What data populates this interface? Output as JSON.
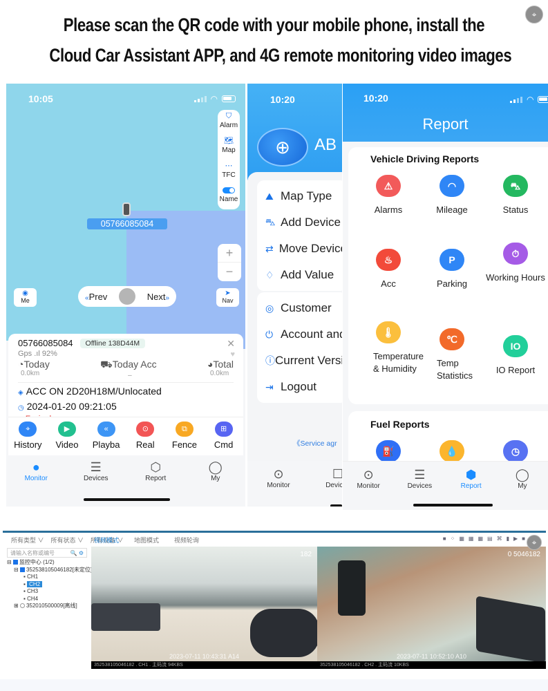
{
  "headline": {
    "line1": "Please scan the QR code with your mobile phone, install the",
    "line2": "Cloud Car Assistant APP, and 4G remote monitoring video images"
  },
  "overlay": {
    "lens_icon": "⌖"
  },
  "phone_monitor": {
    "time": "10:05",
    "side_panel": [
      {
        "icon": "shield-alert-icon",
        "glyph": "⛉",
        "label": "Alarm"
      },
      {
        "icon": "map-icon",
        "glyph": "🗺",
        "label": "Map"
      },
      {
        "icon": "tf-card-icon",
        "glyph": "⋯",
        "label": "TFC"
      },
      {
        "icon": "toggle-icon",
        "glyph": "",
        "label": "Name",
        "toggle_on": true
      }
    ],
    "vehicle_plate": "05766085084",
    "zoom": {
      "plus": "+",
      "minus": "−"
    },
    "me_label": "Me",
    "nav_label": "Nav",
    "prev_label": "Prev",
    "next_label": "Next",
    "card": {
      "device_id": "05766085084",
      "status_badge": "Offline 138D44M",
      "gps": "Gps ⁠.ıl 92%",
      "stats": [
        {
          "icon": "speedometer-icon",
          "glyph": "◔",
          "label": "Today",
          "value": "0.0km"
        },
        {
          "icon": "truck-icon",
          "glyph": "⛟",
          "label": "Today Acc",
          "value": "–"
        },
        {
          "icon": "gauge-icon",
          "glyph": "◕",
          "label": "Total",
          "value": "0.0km"
        }
      ],
      "acc_line": "ACC ON 2D20H18M/Unlocated",
      "datetime": "2024-01-20 09:21:05",
      "expired": "Expired"
    },
    "actions": [
      {
        "label": "History",
        "color": "#2f86f6",
        "glyph": "⌖"
      },
      {
        "label": "Video",
        "color": "#22c08f",
        "glyph": "▶"
      },
      {
        "label": "Playba",
        "color": "#3d95f5",
        "glyph": "«"
      },
      {
        "label": "Real",
        "color": "#f25555",
        "glyph": "⊙"
      },
      {
        "label": "Fence",
        "color": "#f8a823",
        "glyph": "⧉"
      },
      {
        "label": "Cmd",
        "color": "#5865f2",
        "glyph": "⊞"
      }
    ],
    "tabs": [
      {
        "label": "Monitor",
        "glyph": "●",
        "active": true
      },
      {
        "label": "Devices",
        "glyph": "☰",
        "active": false
      },
      {
        "label": "Report",
        "glyph": "⬡",
        "active": false
      },
      {
        "label": "My",
        "glyph": "◯",
        "active": false
      }
    ]
  },
  "phone_my": {
    "time": "10:20",
    "brand": "AB",
    "menu_group1": [
      {
        "label": "Map Type",
        "glyph": "⛰"
      },
      {
        "label": "Add Device",
        "glyph": "⛍"
      },
      {
        "label": "Move Device",
        "glyph": "⇄"
      },
      {
        "label": "Add Value",
        "glyph": "♢"
      }
    ],
    "menu_group2": [
      {
        "label": "Customer",
        "glyph": "◎"
      },
      {
        "label": "Account and",
        "glyph": "⏻"
      },
      {
        "label": "Current Version",
        "glyph": "ⓘ"
      },
      {
        "label": "Logout",
        "glyph": "⇥"
      }
    ],
    "service_link": "《Service agr",
    "tabs": [
      {
        "label": "Monitor",
        "glyph": "⊙"
      },
      {
        "label": "Devices",
        "glyph": "☐"
      }
    ]
  },
  "phone_report": {
    "time": "10:20",
    "title": "Report",
    "vehicle_section": {
      "title": "Vehicle Driving Reports",
      "items": [
        {
          "label": "Alarms",
          "color": "#f25a5a",
          "glyph": "⚠"
        },
        {
          "label": "Mileage",
          "color": "#2f86f6",
          "glyph": "◠"
        },
        {
          "label": "Status",
          "color": "#24b860",
          "glyph": "⛍"
        },
        {
          "label": "Acc",
          "color": "#f24a3a",
          "glyph": "♨"
        },
        {
          "label": "Parking",
          "color": "#2f86f6",
          "glyph": "P"
        },
        {
          "label": "Working Hours",
          "color": "#a55be6",
          "glyph": "⏱"
        },
        {
          "label": "Temperature & Humidity",
          "color": "#fbbf3d",
          "glyph": "🌡"
        },
        {
          "label": "Temp Statistics",
          "color": "#f26a2a",
          "glyph": "℃"
        },
        {
          "label": "IO Report",
          "color": "#22cf9a",
          "glyph": "IO"
        }
      ]
    },
    "fuel_section": {
      "title": "Fuel Reports",
      "items": [
        {
          "color": "#2f6ff6",
          "glyph": "⛽"
        },
        {
          "color": "#fbb52d",
          "glyph": "💧"
        },
        {
          "color": "#5872f2",
          "glyph": "◷"
        }
      ]
    },
    "tabs": [
      {
        "label": "Monitor",
        "glyph": "⊙",
        "active": false
      },
      {
        "label": "Devices",
        "glyph": "☰",
        "active": false
      },
      {
        "label": "Report",
        "glyph": "⬢",
        "active": true
      },
      {
        "label": "My",
        "glyph": "◯",
        "active": false
      }
    ]
  },
  "desktop": {
    "filters": [
      "所有类型 ∨",
      "所有状态 ∨",
      "所有设备 ∨"
    ],
    "view_tabs": [
      {
        "label": "视频模式",
        "active": true
      },
      {
        "label": "地图模式",
        "active": false
      },
      {
        "label": "视频轮询",
        "active": false
      }
    ],
    "toolbar": [
      "■",
      "⁘",
      "▦",
      "▦",
      "▦",
      "▤",
      "⌘",
      "▮",
      "▶",
      "■"
    ],
    "search_placeholder": "请输入名称或编号",
    "tree": [
      {
        "label": "监控中心 (1/2)",
        "level": 0,
        "checked": true,
        "selected": false
      },
      {
        "label": "352538105046182[未定位]",
        "level": 1,
        "checked": true,
        "selected": false
      },
      {
        "label": "CH1",
        "level": 2,
        "checked": false,
        "selected": false
      },
      {
        "label": "CH2",
        "level": 2,
        "checked": false,
        "selected": true
      },
      {
        "label": "CH3",
        "level": 2,
        "checked": false,
        "selected": false
      },
      {
        "label": "CH4",
        "level": 2,
        "checked": false,
        "selected": false
      },
      {
        "label": "352010500009[离线]",
        "level": 1,
        "checked": false,
        "selected": false
      }
    ],
    "videos": [
      {
        "id_overlay": "182",
        "timestamp": "2023-07-11 10:43:31 A14",
        "bar": "352538105046182 . CH1 . 主码流 94KBS"
      },
      {
        "id_overlay": "0 5046182",
        "timestamp": "2023-07-11 10:52:10 A10",
        "bar": "352538105046182 . CH2 . 主码流 10KBS"
      }
    ]
  }
}
